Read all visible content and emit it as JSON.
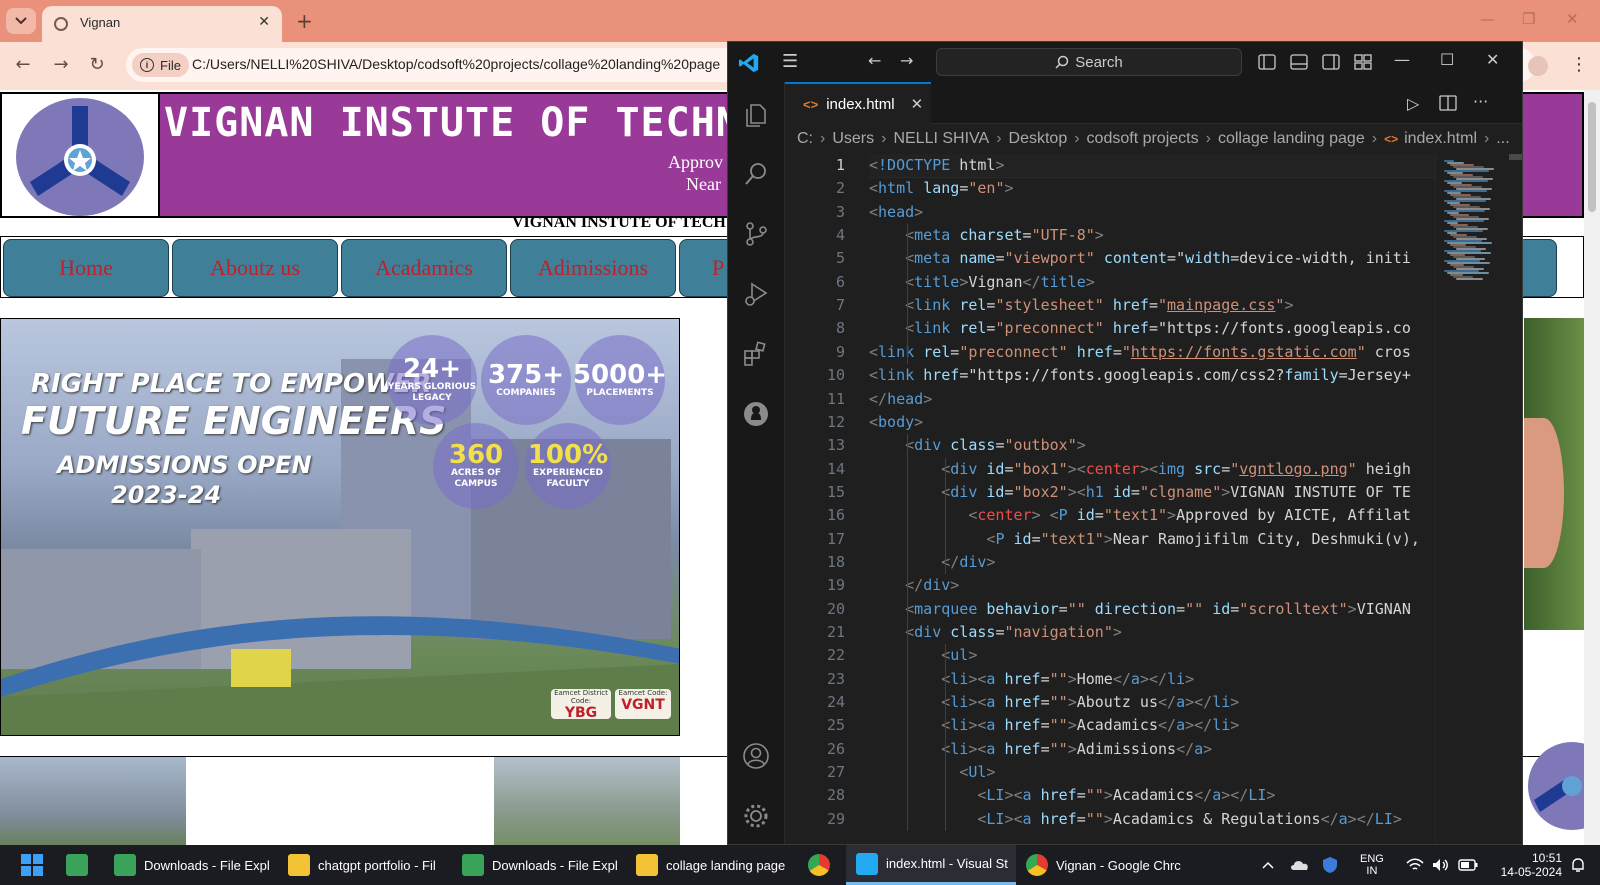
{
  "browser": {
    "tab_title": "Vignan",
    "file_chip": "File",
    "url": "C:/Users/NELLI%20SHIVA/Desktop/codsoft%20projects/collage%20landing%20page"
  },
  "webpage": {
    "college_name": "VIGNAN INSTUTE OF TECHNO",
    "approval_line_1": "Approv",
    "approval_line_2": "Near",
    "marquee": "VIGNAN INSTUTE OF TECH",
    "nav": [
      "Home",
      "Aboutz us",
      "Acadamics",
      "Adimissions",
      "P"
    ],
    "hero": {
      "tagline_1": "RIGHT PLACE TO EMPOWER",
      "tagline_2": "FUTURE ENGINEERS",
      "tagline_3": "ADMISSIONS OPEN",
      "tagline_4": "2023-24",
      "stats": [
        {
          "value": "24+",
          "label": "YEARS GLORIOUS LEGACY"
        },
        {
          "value": "375+",
          "label": "COMPANIES"
        },
        {
          "value": "5000+",
          "label": "PLACEMENTS"
        },
        {
          "value": "360",
          "label": "ACRES OF CAMPUS"
        },
        {
          "value": "100%",
          "label": "EXPERIENCED FACULTY"
        }
      ],
      "codes": [
        {
          "label": "Eamcet District Code:",
          "value": "YBG"
        },
        {
          "label": "Eamcet Code:",
          "value": "VGNT"
        }
      ]
    }
  },
  "vscode": {
    "search_placeholder": "Search",
    "tab_title": "index.html",
    "breadcrumb": [
      "C:",
      "Users",
      "NELLI SHIVA",
      "Desktop",
      "codsoft projects",
      "collage landing page",
      "index.html",
      "..."
    ],
    "line_numbers": [
      "1",
      "2",
      "3",
      "4",
      "5",
      "6",
      "7",
      "8",
      "9",
      "10",
      "11",
      "12",
      "13",
      "14",
      "15",
      "16",
      "17",
      "18",
      "19",
      "20",
      "21",
      "22",
      "23",
      "24",
      "25",
      "26",
      "27",
      "28",
      "29"
    ],
    "code_lines": [
      {
        "indent": "",
        "text": "<!DOCTYPE html>"
      },
      {
        "indent": "",
        "text": "<html lang=\"en\">"
      },
      {
        "indent": "",
        "text": "<head>"
      },
      {
        "indent": "    ",
        "text": "<meta charset=\"UTF-8\">"
      },
      {
        "indent": "    ",
        "text": "<meta name=\"viewport\" content=\"width=device-width, initi"
      },
      {
        "indent": "    ",
        "text": "<title>Vignan</title>"
      },
      {
        "indent": "    ",
        "text": "<link rel=\"stylesheet\" href=\"mainpage.css\">"
      },
      {
        "indent": "    ",
        "text": "<link rel=\"preconnect\" href=\"https://fonts.googleapis.co"
      },
      {
        "indent": "",
        "text": "<link rel=\"preconnect\" href=\"https://fonts.gstatic.com\" cros"
      },
      {
        "indent": "",
        "text": "<link href=\"https://fonts.googleapis.com/css2?family=Jersey+"
      },
      {
        "indent": "",
        "text": "</head>"
      },
      {
        "indent": "",
        "text": "<body>"
      },
      {
        "indent": "    ",
        "text": "<div class=\"outbox\">"
      },
      {
        "indent": "        ",
        "text": "<div id=\"box1\"><center><img src=\"vgntlogo.png\" heigh"
      },
      {
        "indent": "        ",
        "text": "<div id=\"box2\"><h1 id=\"clgname\">VIGNAN INSTUTE OF TE"
      },
      {
        "indent": "           ",
        "text": "<center> <P id=\"text1\">Approved by AICTE, Affilat"
      },
      {
        "indent": "             ",
        "text": "<P id=\"text1\">Near Ramojifilm City, Deshmuki(v),"
      },
      {
        "indent": "        ",
        "text": "</div>"
      },
      {
        "indent": "    ",
        "text": "</div>"
      },
      {
        "indent": "    ",
        "text": "<marquee behavior=\"\" direction=\"\" id=\"scrolltext\">VIGNAN"
      },
      {
        "indent": "    ",
        "text": "<div class=\"navigation\">"
      },
      {
        "indent": "        ",
        "text": "<ul>"
      },
      {
        "indent": "        ",
        "text": "<li><a href=\"\">Home</a></li>"
      },
      {
        "indent": "        ",
        "text": "<li><a href=\"\">Aboutz us</a></li>"
      },
      {
        "indent": "        ",
        "text": "<li><a href=\"\">Acadamics</a></li>"
      },
      {
        "indent": "        ",
        "text": "<li><a href=\"\">Adimissions</a>"
      },
      {
        "indent": "          ",
        "text": "<Ul>"
      },
      {
        "indent": "            ",
        "text": "<LI><a href=\"\">Acadamics</a></LI>"
      },
      {
        "indent": "            ",
        "text": "<LI><a href=\"\">Acadamics & Regulations</a></LI>"
      }
    ]
  },
  "taskbar": {
    "items": [
      "Downloads - File Expl",
      "chatgpt portfolio - Fil",
      "Downloads - File Expl",
      "collage landing page",
      "index.html - Visual St",
      "Vignan - Google Chrc"
    ],
    "language": "ENG",
    "region": "IN",
    "time": "10:51",
    "date": "14-05-2024"
  },
  "colors": {
    "chrome_frame": "#e9917b",
    "header_purple": "#9a3a98",
    "nav_button": "#3f7f98",
    "nav_text": "#c0202a",
    "vscode_bg": "#1f1f1f",
    "vscode_accent": "#0078d4"
  }
}
